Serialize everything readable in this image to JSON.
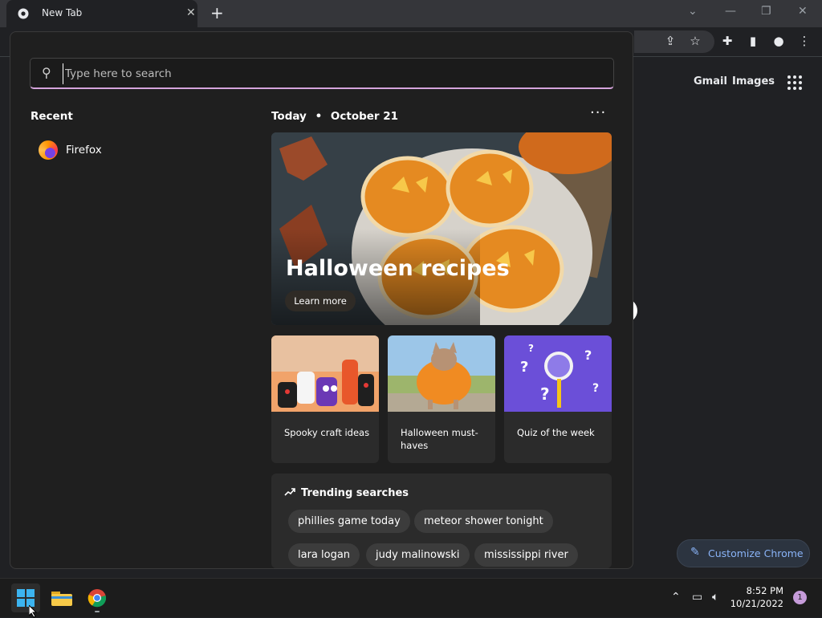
{
  "browser": {
    "tab_title": "New Tab",
    "tab_close_icon": "close-icon",
    "new_tab_icon": "plus-icon"
  },
  "ntp": {
    "links": [
      "Gmail",
      "Images"
    ],
    "customize_label": "Customize Chrome"
  },
  "start": {
    "search_placeholder": "Type here to search",
    "recent_header": "Recent",
    "recent_items": [
      {
        "label": "Firefox",
        "icon": "firefox-icon"
      }
    ],
    "today_label": "Today",
    "date_label": "October 21",
    "hero": {
      "title": "Halloween recipes",
      "button": "Learn more"
    },
    "cards": [
      {
        "label": "Spooky craft ideas"
      },
      {
        "label": "Halloween must-haves"
      },
      {
        "label": "Quiz of the week"
      }
    ],
    "trending": {
      "title": "Trending searches",
      "chips_row1": [
        "phillies game today",
        "meteor shower tonight"
      ],
      "chips_row2": [
        "lara logan",
        "judy malinowski",
        "mississippi river"
      ]
    }
  },
  "taskbar": {
    "time": "8:52 PM",
    "date": "10/21/2022",
    "notification_count": "1"
  },
  "colors": {
    "accent": "#d5a4dc",
    "link_blue": "#8ab4f8"
  }
}
